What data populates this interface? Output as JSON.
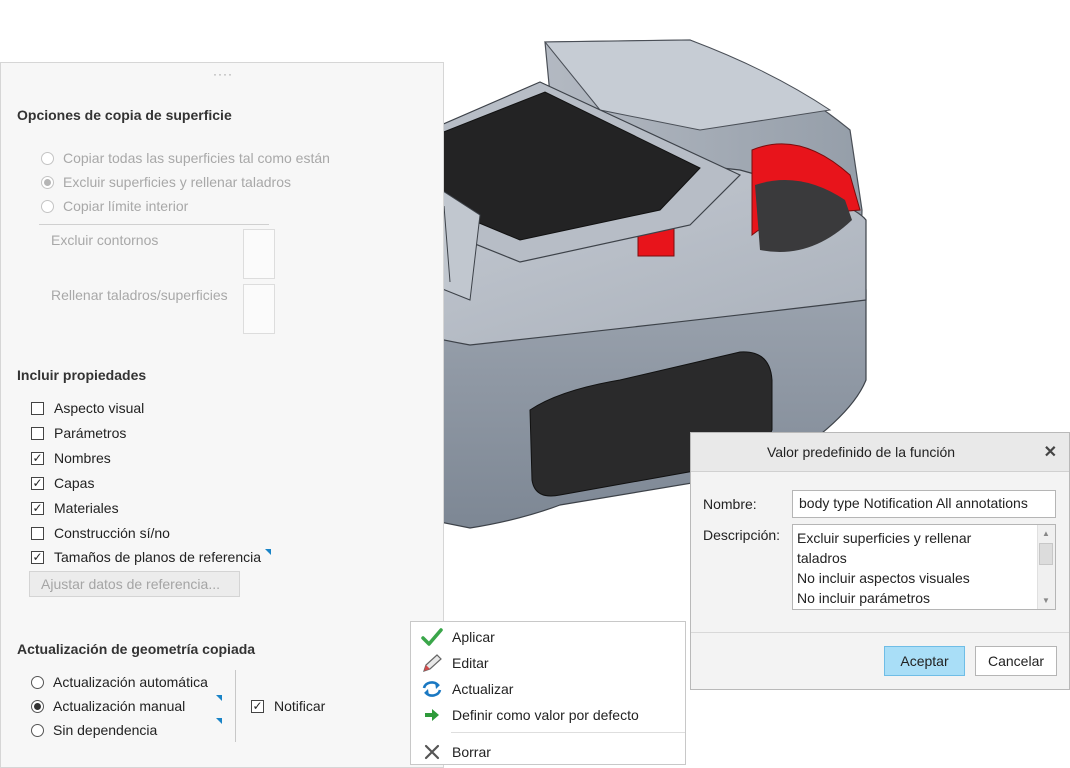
{
  "panel": {
    "surface_copy": {
      "title": "Opciones de copia de superficie",
      "options": [
        {
          "label": "Copiar todas las superficies tal como están",
          "selected": false
        },
        {
          "label": "Excluir superficies y rellenar taladros",
          "selected": true
        },
        {
          "label": "Copiar límite interior",
          "selected": false
        }
      ],
      "exclude_contours_label": "Excluir contornos",
      "fill_holes_label": "Rellenar taladros/superficies"
    },
    "properties": {
      "title": "Incluir propiedades",
      "items": [
        {
          "label": "Aspecto visual",
          "checked": false
        },
        {
          "label": "Parámetros",
          "checked": false
        },
        {
          "label": "Nombres",
          "checked": true
        },
        {
          "label": "Capas",
          "checked": true
        },
        {
          "label": "Materiales",
          "checked": true
        },
        {
          "label": "Construcción sí/no",
          "checked": false
        },
        {
          "label": "Tamaños de planos de referencia",
          "checked": true
        }
      ],
      "adjust_button": "Ajustar datos de referencia..."
    },
    "update": {
      "title": "Actualización de geometría copiada",
      "options": [
        {
          "label": "Actualización automática",
          "selected": false
        },
        {
          "label": "Actualización manual",
          "selected": true
        },
        {
          "label": "Sin dependencia",
          "selected": false
        }
      ],
      "notify_label": "Notificar",
      "notify_checked": true
    }
  },
  "context_menu": {
    "items": [
      {
        "label": "Aplicar",
        "icon": "checkmark-icon"
      },
      {
        "label": "Editar",
        "icon": "pencil-icon"
      },
      {
        "label": "Actualizar",
        "icon": "refresh-icon"
      },
      {
        "label": "Definir como valor por defecto",
        "icon": "arrow-right-icon"
      },
      {
        "label": "Borrar",
        "icon": "close-x-icon"
      }
    ]
  },
  "dialog": {
    "title": "Valor predefinido de la función",
    "name_label": "Nombre:",
    "name_value": "body type Notification All annotations",
    "description_label": "Descripción:",
    "description_lines": [
      "Excluir superficies y rellenar",
      "taladros",
      "No incluir aspectos visuales",
      "No incluir parámetros"
    ],
    "accept_button": "Aceptar",
    "cancel_button": "Cancelar"
  },
  "colors": {
    "accent_blue": "#1a84c7",
    "primary_button": "#a9def7",
    "model_gray": "#8e97a4",
    "model_red": "#e8141b",
    "model_dark": "#2a2a2b"
  }
}
